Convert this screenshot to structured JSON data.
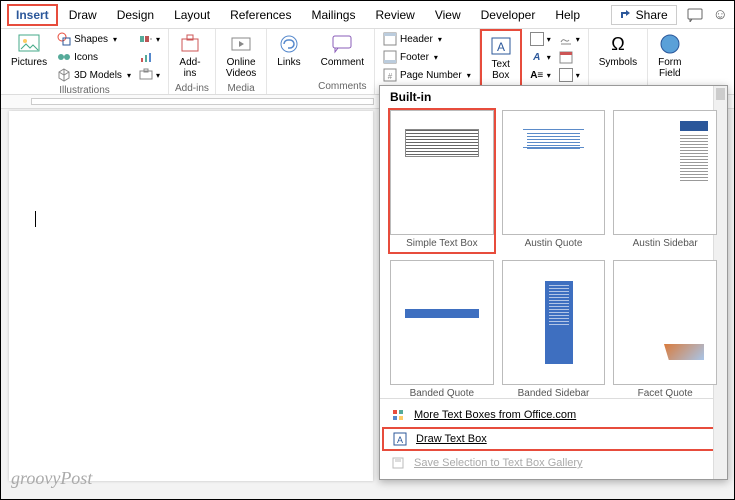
{
  "tabs": [
    "Insert",
    "Draw",
    "Design",
    "Layout",
    "References",
    "Mailings",
    "Review",
    "View",
    "Developer",
    "Help"
  ],
  "share": "Share",
  "ribbon": {
    "illustrations": {
      "label": "Illustrations",
      "pictures": "Pictures",
      "shapes": "Shapes",
      "icons": "Icons",
      "models": "3D Models"
    },
    "addins": {
      "label": "Add-ins",
      "btn": "Add-\nins"
    },
    "media": {
      "label": "Media",
      "btn": "Online\nVideos"
    },
    "links": "Links",
    "comments": {
      "label": "Comments",
      "btn": "Comment"
    },
    "headerfooter": {
      "header": "Header",
      "footer": "Footer",
      "pagenum": "Page Number"
    },
    "textbox": "Text\nBox",
    "symbols": "Symbols",
    "formfield": "Form\nField"
  },
  "gallery": {
    "heading": "Built-in",
    "items": [
      {
        "label": "Simple Text Box",
        "cls": "t-simple"
      },
      {
        "label": "Austin Quote",
        "cls": "t-aq"
      },
      {
        "label": "Austin Sidebar",
        "cls": "t-as"
      },
      {
        "label": "Banded Quote",
        "cls": "t-bq"
      },
      {
        "label": "Banded Sidebar",
        "cls": "t-bs"
      },
      {
        "label": "Facet Quote",
        "cls": "t-fq"
      }
    ],
    "more": "More Text Boxes from Office.com",
    "draw": "Draw Text Box",
    "save": "Save Selection to Text Box Gallery"
  },
  "watermark": "groovyPost"
}
